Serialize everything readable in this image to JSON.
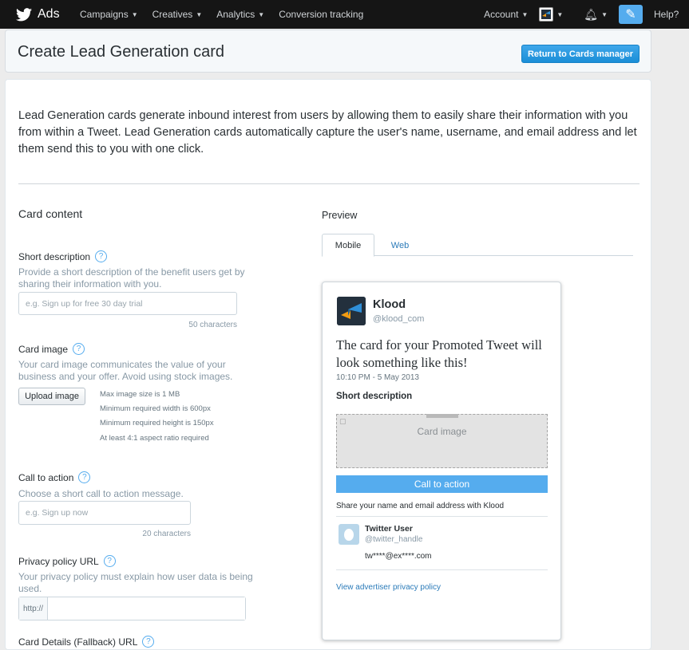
{
  "nav": {
    "brand": "Ads",
    "links": [
      "Campaigns",
      "Creatives",
      "Analytics"
    ],
    "conversion": "Conversion tracking",
    "account": "Account",
    "help": "Help?"
  },
  "header": {
    "title": "Create Lead Generation card",
    "return_button": "Return to Cards manager"
  },
  "intro": "Lead Generation cards generate inbound interest from users by allowing them to easily share their information with you from within a Tweet. Lead Generation cards automatically capture the user's name, username, and email address and let them send this to you with one click.",
  "form": {
    "section_title": "Card content",
    "short_description": {
      "label": "Short description",
      "help": "Provide a short description of the benefit users get by sharing their information with you.",
      "placeholder": "e.g. Sign up for free 30 day trial",
      "count": "50 characters"
    },
    "card_image": {
      "label": "Card image",
      "help": "Your card image communicates the value of your business and your offer. Avoid using stock images.",
      "button": "Upload image",
      "requirements": [
        "Max image size is 1 MB",
        "Minimum required width is 600px",
        "Minimum required height is 150px",
        "At least 4:1 aspect ratio required"
      ]
    },
    "call_to_action": {
      "label": "Call to action",
      "help": "Choose a short call to action message.",
      "placeholder": "e.g. Sign up now",
      "count": "20 characters"
    },
    "privacy_url": {
      "label": "Privacy policy URL",
      "help": "Your privacy policy must explain how user data is being used.",
      "prefix": "http://"
    },
    "fallback_url": {
      "label": "Card Details (Fallback) URL"
    }
  },
  "preview": {
    "title": "Preview",
    "tabs": [
      "Mobile",
      "Web"
    ],
    "card": {
      "name": "Klood",
      "handle": "@klood_com",
      "tweet": "The card for your Promoted Tweet will look something like this!",
      "time": "10:10 PM - 5 May 2013",
      "short_description": "Short description",
      "image_label": "Card image",
      "cta": "Call to action",
      "share_text": "Share your name and email address with Klood",
      "user_name": "Twitter User",
      "user_handle": "@twitter_handle",
      "user_email": "tw****@ex****.com",
      "privacy_link": "View advertiser privacy policy"
    }
  },
  "colors": {
    "accent": "#55acee",
    "link": "#2b7bb9",
    "nav_bg": "#151515"
  }
}
